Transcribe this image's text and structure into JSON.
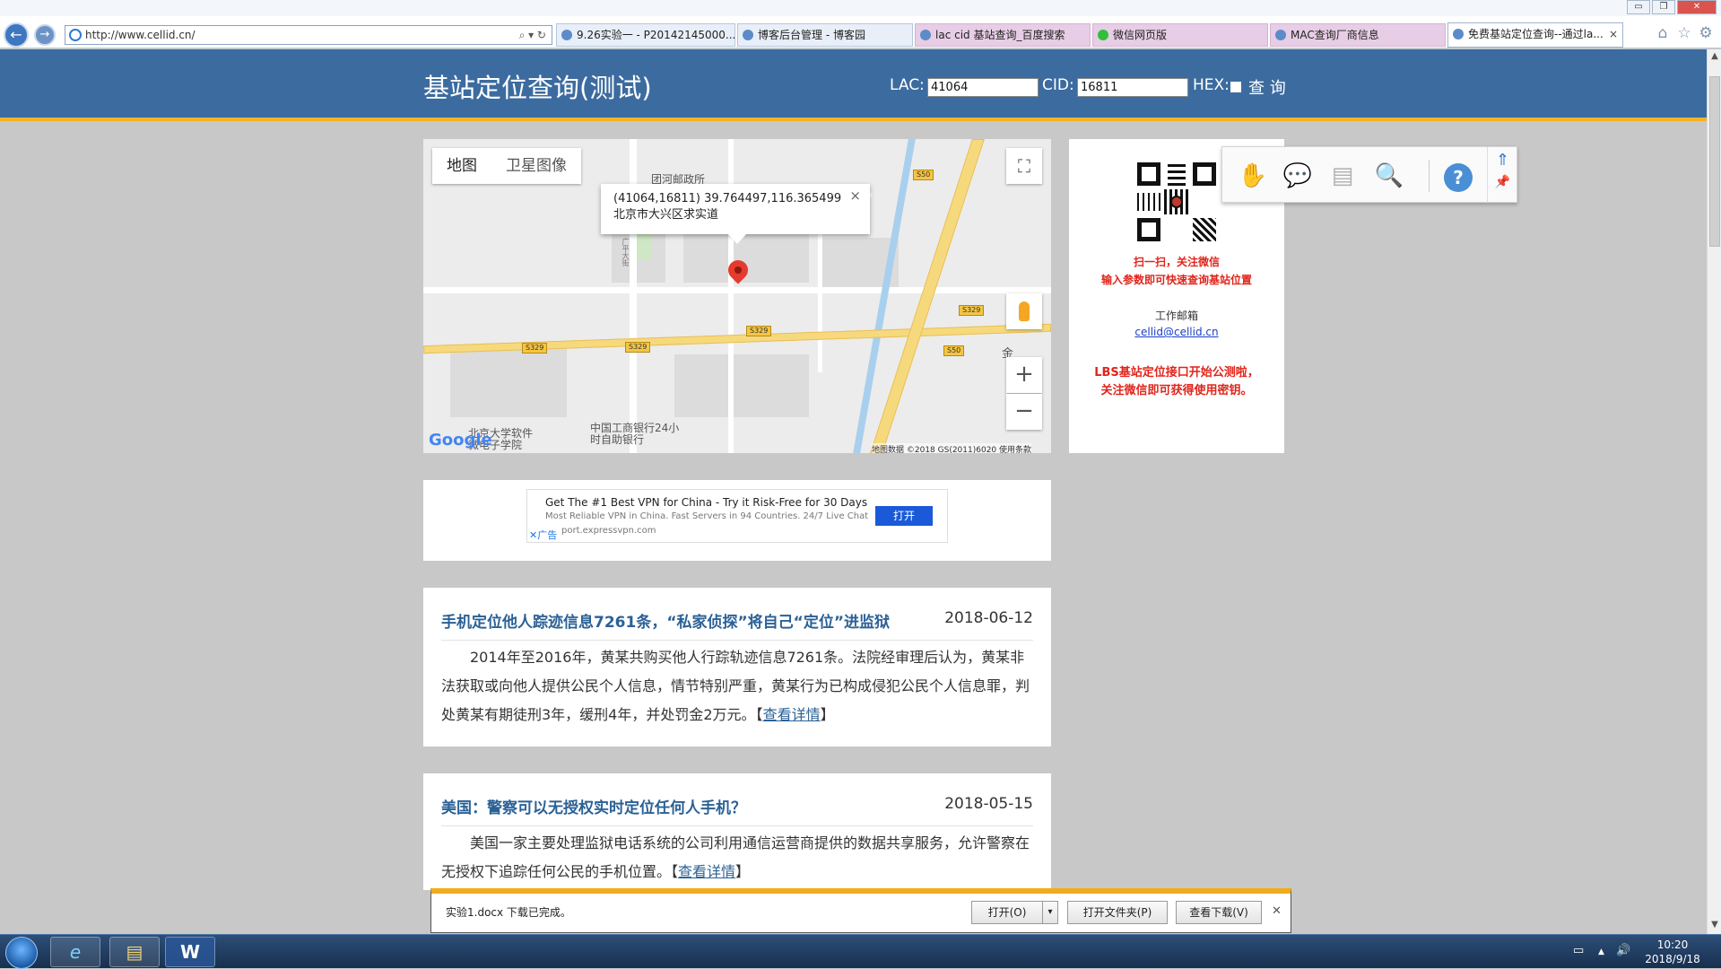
{
  "browser": {
    "address": "http://www.cellid.cn/",
    "tabs": [
      {
        "label": "9.26实验一 - P20142145000...",
        "style": "normal"
      },
      {
        "label": "博客后台管理 - 博客园",
        "style": "normal"
      },
      {
        "label": "lac cid 基站查询_百度搜索",
        "style": "pink"
      },
      {
        "label": "微信网页版",
        "style": "pink"
      },
      {
        "label": "MAC查询厂商信息",
        "style": "pink"
      },
      {
        "label": "免费基站定位查询--通过la...",
        "style": "active"
      }
    ],
    "tab_close": "×",
    "window_controls": {
      "minimize": "▭",
      "restore": "❐",
      "close": "✕"
    },
    "toolbar_icons": [
      "home-icon",
      "favorites-star-icon",
      "settings-gear-icon"
    ],
    "address_tools": "⌕ ▾ ↻"
  },
  "header": {
    "title": "基站定位查询(测试)",
    "lac_label": "LAC:",
    "lac_value": "41064",
    "cid_label": "CID:",
    "cid_value": "16811",
    "hex_label": "HEX:",
    "query_label": "查 询"
  },
  "map": {
    "map_type_map": "地图",
    "map_type_satellite": "卫星图像",
    "info_coords": "(41064,16811) 39.764497,116.365499",
    "info_address": "北京市大兴区求实道",
    "info_close": "×",
    "zoom_in": "+",
    "zoom_out": "−",
    "fullscreen": "⛶",
    "google": "Google",
    "footer": "地图数据 ©2018 GS(2011)6020   使用条款",
    "labels": {
      "post_office": "团河邮政所",
      "bank": "中国工商银行24小时自助银行",
      "school": "北京大学软件微电子学院",
      "street_v": "广平大街",
      "jin": "金"
    },
    "shields": [
      "S50",
      "S329",
      "S329",
      "S329",
      "S329",
      "S50"
    ]
  },
  "side": {
    "scan_line1": "扫一扫，关注微信",
    "scan_line2": "输入参数即可快速查询基站位置",
    "email_label": "工作邮箱",
    "email": "cellid@cellid.cn",
    "lbs_line1": "LBS基站定位接口开始公测啦，",
    "lbs_line2": "关注微信即可获得使用密钥。"
  },
  "pdf_toolbar": {
    "icons": [
      "hand-tool-icon",
      "comment-icon",
      "export-icon",
      "zoom-search-icon",
      "help-icon",
      "collapse-up-icon",
      "pin-icon"
    ],
    "help_symbol": "?"
  },
  "ad": {
    "headline": "Get The #1 Best VPN for China - Try it Risk-Free for 30 Days",
    "desc": "Most Reliable VPN in China. Fast Servers in 94 Countries. 24/7 Live Chat",
    "url": "port.expressvpn.com",
    "badge": "广告",
    "open": "打开",
    "close_symbol": "✕"
  },
  "news": [
    {
      "title": "手机定位他人踪迹信息7261条，“私家侦探”将自己“定位”进监狱",
      "date": "2018-06-12",
      "body": "2014年至2016年，黄某共购买他人行踪轨迹信息7261条。法院经审理后认为，黄某非法获取或向他人提供公民个人信息，情节特别严重，黄某行为已构成侵犯公民个人信息罪，判处黄某有期徒刑3年，缓刑4年，并处罚金2万元。",
      "more": "查看详情"
    },
    {
      "title": "美国：警察可以无授权实时定位任何人手机？",
      "date": "2018-05-15",
      "body": "美国一家主要处理监狱电话系统的公司利用通信运营商提供的数据共享服务，允许警察在无授权下追踪任何公民的手机位置。",
      "more": "查看详情"
    }
  ],
  "bracket_open": "【",
  "bracket_close": "】",
  "download": {
    "message": "实验1.docx 下载已完成。",
    "open": "打开(O)",
    "open_arrow": "▾",
    "open_folder": "打开文件夹(P)",
    "view_downloads": "查看下载(V)",
    "close": "✕"
  },
  "taskbar": {
    "apps": [
      "internet-explorer-icon",
      "file-explorer-icon",
      "word-icon"
    ],
    "app_glyphs": [
      "e",
      "▤",
      "W"
    ],
    "tray_glyphs": [
      "▭",
      "▲",
      "🔊"
    ],
    "time": "10:20",
    "date": "2018/9/18"
  }
}
